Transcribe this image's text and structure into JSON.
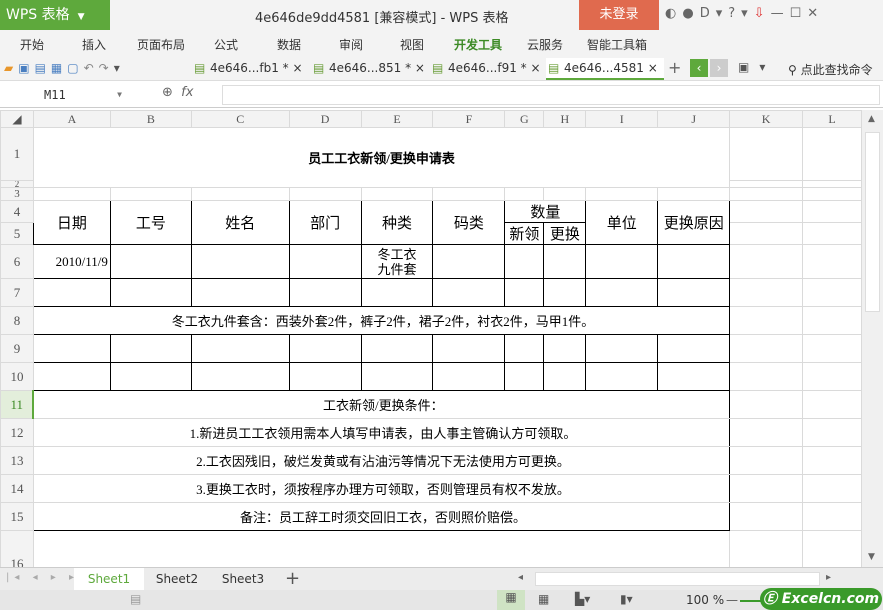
{
  "app": {
    "logo": "WPS 表格",
    "window_title": "4e646de9dd4581 [兼容模式] - WPS 表格",
    "login": "未登录"
  },
  "menu": [
    "开始",
    "插入",
    "页面布局",
    "公式",
    "数据",
    "审阅",
    "视图",
    "开发工具",
    "云服务",
    "智能工具箱"
  ],
  "doc_tabs": [
    "4e646...fb1 *",
    "4e646...851 *",
    "4e646...f91 *",
    "4e646...4581"
  ],
  "find_command": "点此查找命令",
  "formula_bar": {
    "name_box": "M11",
    "fx": "fx",
    "value": ""
  },
  "columns": [
    "A",
    "B",
    "C",
    "D",
    "E",
    "F",
    "G",
    "H",
    "I",
    "J",
    "K",
    "L"
  ],
  "rows": [
    "1",
    "2",
    "3",
    "4",
    "5",
    "6",
    "7",
    "8",
    "9",
    "10",
    "11",
    "12",
    "13",
    "14",
    "15",
    "16"
  ],
  "sheet": {
    "title": "员工工衣新领/更换申请表",
    "headers": {
      "date": "日期",
      "id": "工号",
      "name": "姓名",
      "dept": "部门",
      "type": "种类",
      "size": "码类",
      "qty": "数量",
      "qty_new": "新领",
      "qty_replace": "更换",
      "unit": "单位",
      "reason": "更换原因"
    },
    "row6": {
      "date": "2010/11/9",
      "type_line1": "冬工衣",
      "type_line2": "九件套"
    },
    "note8": "冬工衣九件套含：西装外套2件，裤子2件，裙子2件，衬衣2件，马甲1件。",
    "conditions": [
      "工衣新领/更换条件：",
      "1.新进员工工衣领用需本人填写申请表，由人事主管确认方可领取。",
      "2.工衣因残旧，破烂发黄或有沾油污等情况下无法使用方可更换。",
      "3.更换工衣时，须按程序办理方可领取，否则管理员有权不发放。",
      "备注：员工辞工时须交回旧工衣，否则照价赔偿。"
    ]
  },
  "sheet_tabs": [
    "Sheet1",
    "Sheet2",
    "Sheet3"
  ],
  "status": {
    "zoom": "100 %"
  },
  "watermark": "Excelcn.com",
  "colors": {
    "accent": "#5ea93c",
    "login": "#e06a4e"
  }
}
